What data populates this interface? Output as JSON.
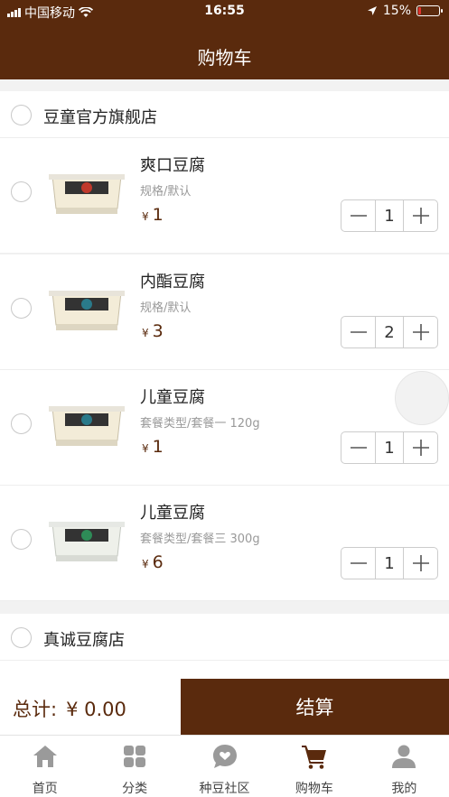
{
  "status_bar": {
    "carrier": "中国移动",
    "time": "16:55",
    "battery": "15%",
    "battery_level": 0.15
  },
  "header": {
    "title": "购物车"
  },
  "stores": [
    {
      "name": "豆童官方旗舰店",
      "items": [
        {
          "name": "爽口豆腐",
          "spec": "规格/默认",
          "currency": "¥",
          "price": "1",
          "qty": "1",
          "label_color": "#c0392b"
        },
        {
          "name": "内酯豆腐",
          "spec": "规格/默认",
          "currency": "¥",
          "price": "3",
          "qty": "2",
          "label_color": "#2a7a8a"
        },
        {
          "name": "儿童豆腐",
          "spec": "套餐类型/套餐一 120g",
          "currency": "¥",
          "price": "1",
          "qty": "1",
          "label_color": "#2a7a8a"
        },
        {
          "name": "儿童豆腐",
          "spec": "套餐类型/套餐三 300g",
          "currency": "¥",
          "price": "6",
          "qty": "1",
          "label_color": "#2e8b57"
        }
      ]
    },
    {
      "name": "真诚豆腐店",
      "items": []
    }
  ],
  "checkout": {
    "total_label": "总计:",
    "total_amount": "¥ 0.00",
    "pay_label": "结算"
  },
  "tabbar": [
    {
      "label": "首页",
      "icon": "home-icon",
      "active": false
    },
    {
      "label": "分类",
      "icon": "category-icon",
      "active": false
    },
    {
      "label": "种豆社区",
      "icon": "chat-heart-icon",
      "active": false
    },
    {
      "label": "购物车",
      "icon": "cart-icon",
      "active": true
    },
    {
      "label": "我的",
      "icon": "user-icon",
      "active": false
    }
  ],
  "colors": {
    "brand": "#5a2a0d",
    "active_icon": "#5a2a0d",
    "inactive_icon": "#9a9a9a"
  }
}
